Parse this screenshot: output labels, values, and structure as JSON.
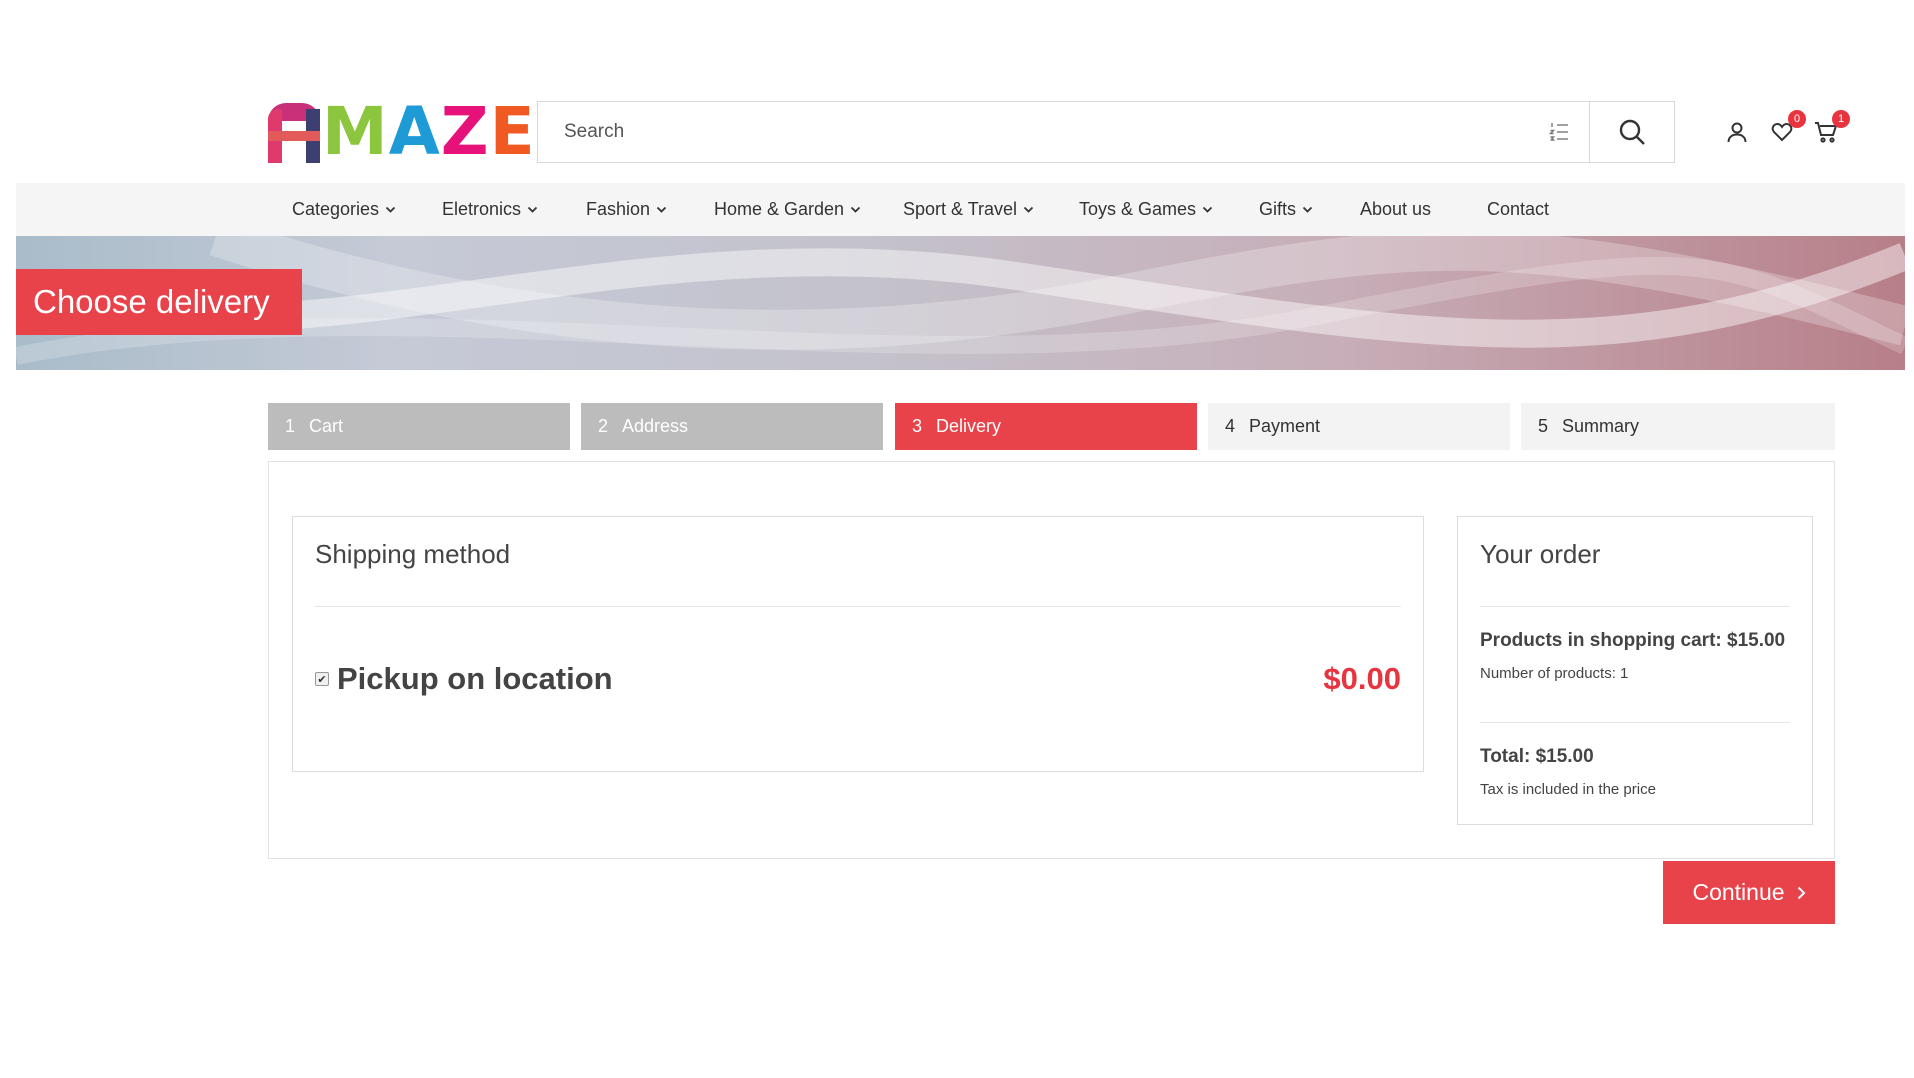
{
  "logo": {
    "text": "AMAZE",
    "rest": [
      "M",
      "A",
      "Z",
      "E"
    ]
  },
  "search": {
    "placeholder": "Search"
  },
  "header": {
    "wishlist_count": "0",
    "cart_count": "1"
  },
  "nav": {
    "items": [
      {
        "label": "Categories",
        "dropdown": true
      },
      {
        "label": "Eletronics",
        "dropdown": true
      },
      {
        "label": "Fashion",
        "dropdown": true
      },
      {
        "label": "Home & Garden",
        "dropdown": true
      },
      {
        "label": "Sport & Travel",
        "dropdown": true
      },
      {
        "label": "Toys & Games",
        "dropdown": true
      },
      {
        "label": "Gifts",
        "dropdown": true
      },
      {
        "label": "About us",
        "dropdown": false
      },
      {
        "label": "Contact",
        "dropdown": false
      }
    ]
  },
  "banner": {
    "title": "Choose delivery"
  },
  "steps": [
    {
      "num": "1",
      "label": "Cart",
      "state": "done"
    },
    {
      "num": "2",
      "label": "Address",
      "state": "done"
    },
    {
      "num": "3",
      "label": "Delivery",
      "state": "active"
    },
    {
      "num": "4",
      "label": "Payment",
      "state": "todo"
    },
    {
      "num": "5",
      "label": "Summary",
      "state": "todo"
    }
  ],
  "shipping": {
    "title": "Shipping method",
    "method_name": "Pickup on location",
    "method_price": "$0.00",
    "checked": true
  },
  "order": {
    "title": "Your order",
    "products_line": "Products in shopping cart: $15.00",
    "count_line": "Number of products: 1",
    "total_line": "Total: $15.00",
    "tax_line": "Tax is included in the price"
  },
  "actions": {
    "continue_label": "Continue"
  },
  "colors": {
    "accent": "#e8434b",
    "price": "#e8343e",
    "step_done": "#bcbcbc",
    "step_todo": "#f3f3f3"
  }
}
